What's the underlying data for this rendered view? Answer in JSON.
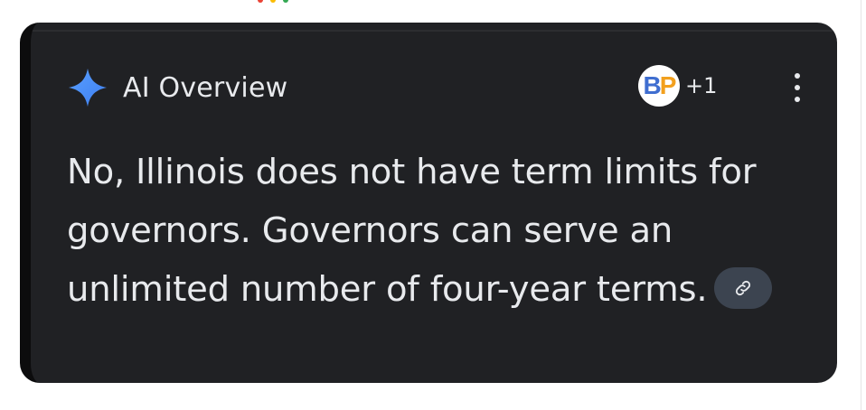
{
  "overview": {
    "title": "AI Overview",
    "icon": "sparkle-icon",
    "sources": {
      "favicon_text_1": "B",
      "favicon_text_2": "P",
      "more_count": "+1"
    },
    "answer_text": "No, Illinois does not have term limits for governors. Governors can serve an unlimited number of four-year terms.",
    "link_icon": "link-icon",
    "menu_icon": "more-vert-icon"
  },
  "colors": {
    "card_background": "#202124",
    "text": "#e8eaed",
    "sparkle_blue": "#4c8df6",
    "favicon_b": "#3f6ed0",
    "favicon_p": "#f2a01e",
    "chip_background": "#3c4450"
  }
}
